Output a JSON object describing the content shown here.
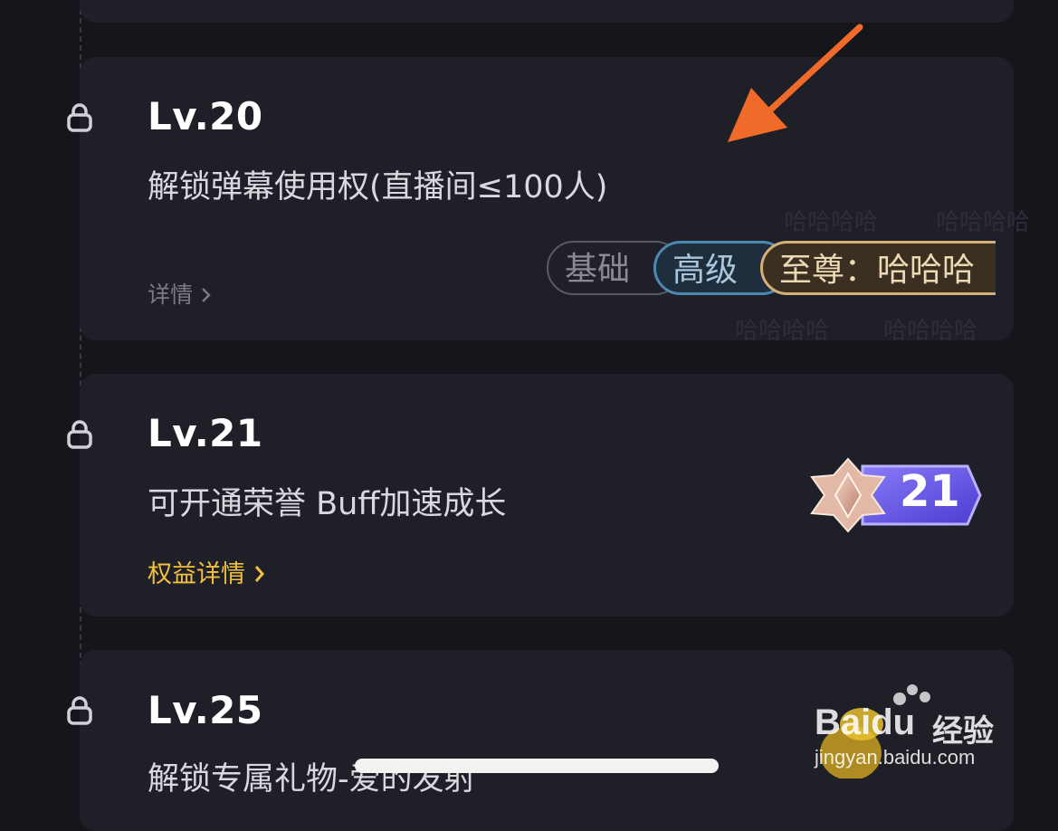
{
  "levels": [
    {
      "level": "Lv.20",
      "description": "解锁弹幕使用权(直播间≤100人)",
      "detail_label": "详情",
      "tiers": {
        "basic": "基础",
        "advanced": "高级",
        "supreme": "至尊：哈哈哈"
      },
      "watermark_text": "哈哈哈哈"
    },
    {
      "level": "Lv.21",
      "description": "可开通荣誉 Buff加速成长",
      "detail_label": "权益详情",
      "badge_number": "21"
    },
    {
      "level": "Lv.25",
      "description": "解锁专属礼物-爱的发射"
    }
  ],
  "watermark": {
    "brand": "Baidu",
    "brand_cn": "经验",
    "url": "jingyan.baidu.com"
  },
  "colors": {
    "background": "#15151c",
    "card": "#1f1f28",
    "accent_gold": "#f0c040",
    "arrow": "#f06a2a",
    "badge_purple": "#6a5cf0"
  },
  "icons": {
    "lock": "lock-icon",
    "chevron": "chevron-right-icon",
    "arrow": "annotation-arrow-icon",
    "badge": "level-badge-icon"
  }
}
